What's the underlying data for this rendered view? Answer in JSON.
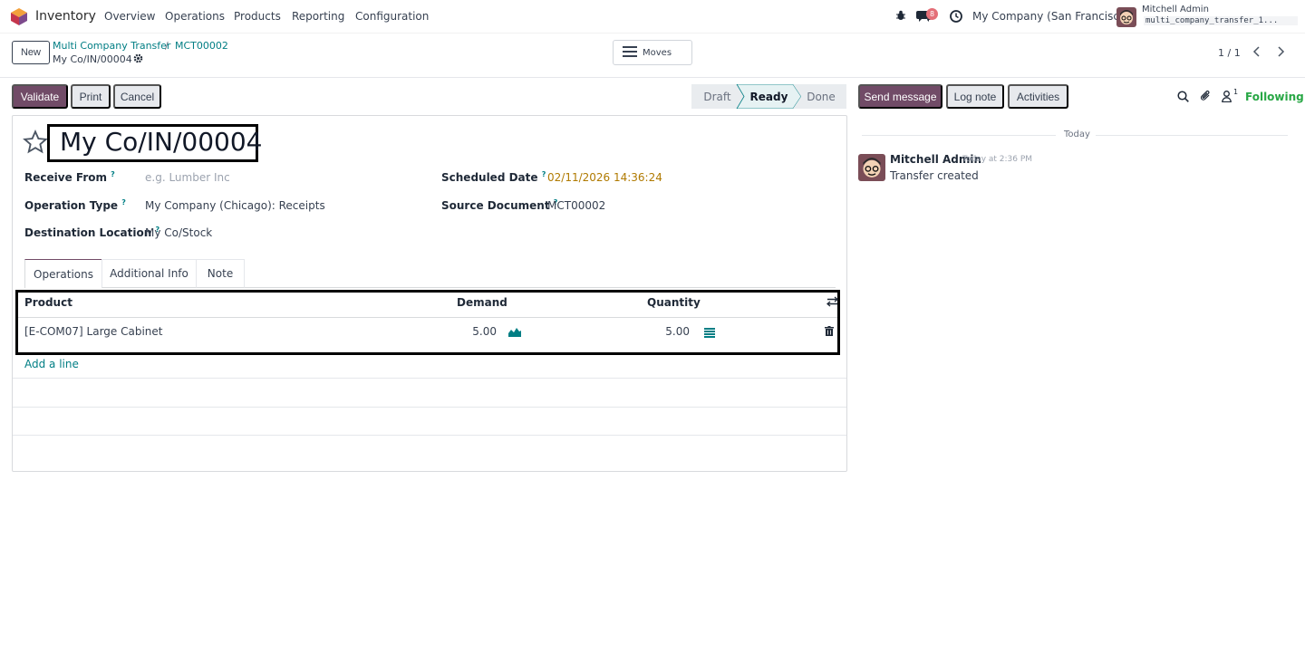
{
  "navbar": {
    "app_name": "Inventory",
    "menu": [
      "Overview",
      "Operations",
      "Products",
      "Reporting",
      "Configuration"
    ],
    "messages_count": "8",
    "company": "My Company (San Francisco)",
    "user_name": "Mitchell Admin",
    "db_name": "multi_company_transfer_1..."
  },
  "control_panel": {
    "new_label": "New",
    "breadcrumb": [
      "Multi Company Transfer",
      "MCT00002"
    ],
    "current": "My Co/IN/00004",
    "moves_label": "Moves",
    "pager": "1 / 1"
  },
  "actions": {
    "validate": "Validate",
    "print": "Print",
    "cancel": "Cancel"
  },
  "status_bar": {
    "stages": [
      "Draft",
      "Ready",
      "Done"
    ],
    "active": "Ready"
  },
  "form": {
    "title": "My Co/IN/00004",
    "receive_from_label": "Receive From",
    "receive_from_placeholder": "e.g. Lumber Inc",
    "operation_type_label": "Operation Type",
    "operation_type_value": "My Company (Chicago): Receipts",
    "destination_label": "Destination Location",
    "destination_value": "My Co/Stock",
    "scheduled_date_label": "Scheduled Date",
    "scheduled_date_value": "02/11/2026 14:36:24",
    "source_document_label": "Source Document",
    "source_document_value": "MCT00002",
    "help_mark": "?"
  },
  "tabs": [
    "Operations",
    "Additional Info",
    "Note"
  ],
  "table": {
    "headers": [
      "Product",
      "Demand",
      "Quantity"
    ],
    "rows": [
      {
        "product": "[E-COM07] Large Cabinet",
        "demand": "5.00",
        "quantity": "5.00"
      }
    ],
    "add_line": "Add a line"
  },
  "chatter": {
    "send_message": "Send message",
    "log_note": "Log note",
    "activities": "Activities",
    "followers_count": "1",
    "following": "Following",
    "date_separator": "Today",
    "messages": [
      {
        "author": "Mitchell Admin",
        "time": "Today at 2:36 PM",
        "body": "Transfer created"
      }
    ]
  },
  "colors": {
    "primary": "#714b67",
    "link": "#017e84",
    "following": "#28a745",
    "date": "#b07a00"
  }
}
